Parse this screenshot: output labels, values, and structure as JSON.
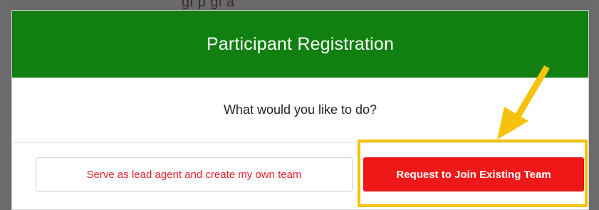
{
  "background": {
    "partial_text": "gi p gi a"
  },
  "modal": {
    "title": "Participant Registration",
    "question": "What would you like to do?",
    "buttons": {
      "create_team_label": "Serve as lead agent and create my own team",
      "join_team_label": "Request to Join Existing Team"
    }
  },
  "annotation": {
    "color": "#f5c20c",
    "arrow_icon": "arrow-down-left-icon"
  },
  "colors": {
    "header_green": "#118011",
    "primary_red": "#ef1818",
    "outline_text_red": "#e0202a"
  }
}
